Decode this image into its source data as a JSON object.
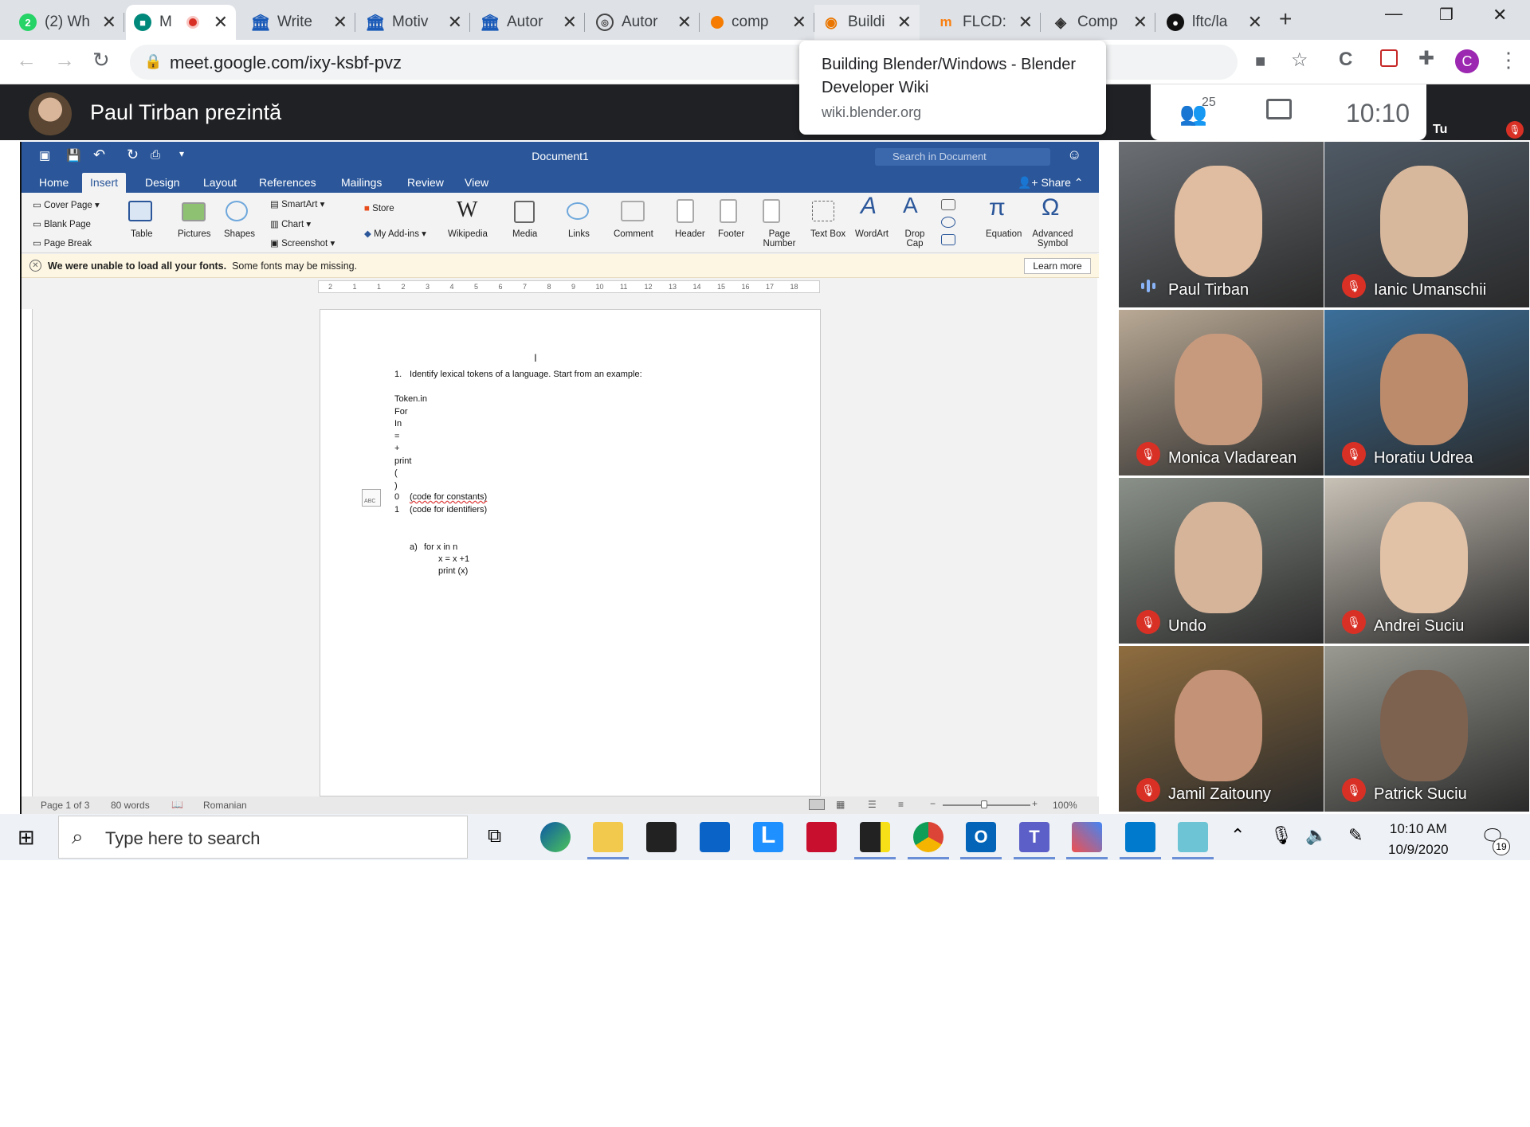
{
  "browser": {
    "tabs": [
      {
        "title": "(2) Wh",
        "icon": "whatsapp-icon",
        "badge": "2",
        "color": "#25d366"
      },
      {
        "title": "M",
        "icon": "meet-icon",
        "recording": true,
        "color": "#00897b"
      },
      {
        "title": "Write",
        "icon": "university-icon",
        "color": "#1a5ab8"
      },
      {
        "title": "Motiv",
        "icon": "university-icon",
        "color": "#1a5ab8"
      },
      {
        "title": "Autor",
        "icon": "university-icon",
        "color": "#1a5ab8"
      },
      {
        "title": "Autor",
        "icon": "globe-icon",
        "color": "#444"
      },
      {
        "title": "comp",
        "icon": "orange-circle-icon",
        "color": "#f57c00"
      },
      {
        "title": "Buildi",
        "icon": "blender-icon",
        "color": "#ea7600"
      },
      {
        "title": "FLCD:",
        "icon": "moodle-icon",
        "color": "#f98012"
      },
      {
        "title": "Comp",
        "icon": "diamond-icon",
        "color": "#333"
      },
      {
        "title": "lftc/la",
        "icon": "github-icon",
        "color": "#111"
      }
    ],
    "url": "meet.google.com/ixy-ksbf-pvz",
    "profile_initial": "C",
    "tooltip": {
      "title": "Building Blender/Windows - Blender Developer Wiki",
      "url": "wiki.blender.org"
    }
  },
  "meet": {
    "presenter_text": "Paul Tirban prezintă",
    "participants_count": "25",
    "time": "10:10",
    "self_label": "Tu",
    "participants": [
      {
        "name": "Paul Tirban",
        "muted": false
      },
      {
        "name": "Ianic Umanschii",
        "muted": true
      },
      {
        "name": "Monica Vladarean",
        "muted": true
      },
      {
        "name": "Horatiu Udrea",
        "muted": true
      },
      {
        "name": "Undo",
        "muted": true
      },
      {
        "name": "Andrei Suciu",
        "muted": true
      },
      {
        "name": "Jamil Zaitouny",
        "muted": true
      },
      {
        "name": "Patrick Suciu",
        "muted": true
      }
    ]
  },
  "word": {
    "doc_title": "Document1",
    "search_placeholder": "Search in Document",
    "tabs": [
      "Home",
      "Insert",
      "Design",
      "Layout",
      "References",
      "Mailings",
      "Review",
      "View"
    ],
    "active_tab": "Insert",
    "share_label": "Share",
    "ribbon": {
      "cover_page": "Cover Page",
      "blank_page": "Blank Page",
      "page_break": "Page Break",
      "table": "Table",
      "pictures": "Pictures",
      "shapes": "Shapes",
      "smartart": "SmartArt",
      "chart": "Chart",
      "screenshot": "Screenshot",
      "store": "Store",
      "my_addins": "My Add-ins",
      "wikipedia": "Wikipedia",
      "media": "Media",
      "links": "Links",
      "comment": "Comment",
      "header": "Header",
      "footer": "Footer",
      "page_number": "Page Number",
      "text_box": "Text Box",
      "wordart": "WordArt",
      "drop_cap": "Drop Cap",
      "equation": "Equation",
      "advanced_symbol": "Advanced Symbol"
    },
    "font_warning_bold": "We were unable to load all your fonts.",
    "font_warning_rest": "Some fonts may be missing.",
    "learn_more": "Learn more",
    "ruler_numbers": [
      "2",
      "1",
      "1",
      "2",
      "3",
      "4",
      "5",
      "6",
      "7",
      "8",
      "9",
      "10",
      "11",
      "12",
      "13",
      "14",
      "15",
      "16",
      "17",
      "18"
    ],
    "document": {
      "heading_num": "1.",
      "heading": "Identify lexical tokens of a language. Start from an example:",
      "tokens": [
        "Token.in",
        "For",
        "In",
        "=",
        "+",
        "print",
        "(",
        ")"
      ],
      "code_constants_num": "0",
      "code_constants": "(code for constants)",
      "code_identifiers_num": "1",
      "code_identifiers": "(code for identifiers)",
      "example_label": "a)",
      "example_lines": [
        "for x in n",
        "x = x +1",
        "print (x)"
      ]
    },
    "status": {
      "page": "Page 1 of 3",
      "words": "80 words",
      "language": "Romanian",
      "zoom": "100%"
    }
  },
  "taskbar": {
    "search_placeholder": "Type here to search",
    "time": "10:10 AM",
    "date": "10/9/2020",
    "notification_count": "19"
  }
}
